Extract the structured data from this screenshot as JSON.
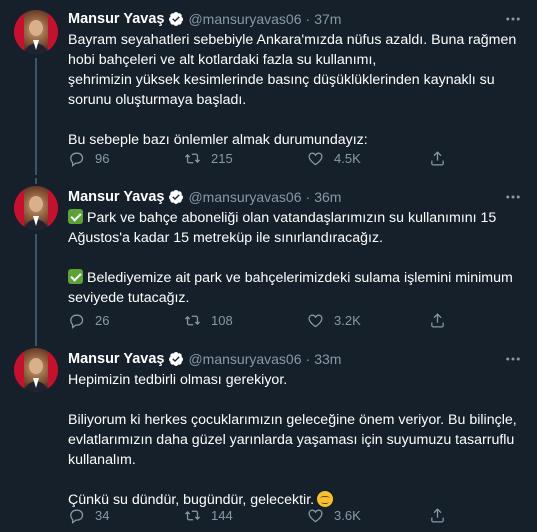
{
  "tweets": [
    {
      "name": "Mansur Yavaş",
      "handle": "@mansuryavas06",
      "dot": "·",
      "time": "37m",
      "lines": [
        "Bayram seyahatleri sebebiyle Ankara'mızda nüfus azaldı. Buna rağmen",
        "hobi bahçeleri ve alt kotlardaki fazla su kullanımı,",
        "şehrimizin yüksek kesimlerinde basınç düşüklüklerinden kaynaklı su",
        "sorunu oluşturmaya başladı.",
        "Bu sebeple bazı önlemler almak durumundayız:"
      ],
      "reply_count": "96",
      "retweet_count": "215",
      "like_count": "4.5K"
    },
    {
      "name": "Mansur Yavaş",
      "handle": "@mansuryavas06",
      "dot": "·",
      "time": "36m",
      "lines": [
        "Park ve bahçe aboneliği olan vatandaşlarımızın su kullanımını 15",
        "Ağustos'a kadar 15 metreküp ile sınırlandıracağız.",
        "Belediyemize ait park ve bahçelerimizdeki sulama işlemini minimum",
        "seviyede tutacağız."
      ],
      "reply_count": "26",
      "retweet_count": "108",
      "like_count": "3.2K"
    },
    {
      "name": "Mansur Yavaş",
      "handle": "@mansuryavas06",
      "dot": "·",
      "time": "33m",
      "lines": [
        "Hepimizin tedbirli olması gerekiyor.",
        "Biliyorum ki herkes çocuklarımızın geleceğine önem veriyor. Bu bilinçle,",
        "evlatlarımızın daha güzel yarınlarda yaşaması için suyumuzu tasarruflu",
        "kullanalım.",
        "Çünkü su dündür, bugündür, gelecektir."
      ],
      "reply_count": "34",
      "retweet_count": "144",
      "like_count": "3.6K"
    }
  ],
  "icons": {
    "verified": "verified-badge-icon",
    "more": "more-options-icon",
    "reply": "reply-icon",
    "retweet": "retweet-icon",
    "like": "like-icon",
    "share": "share-icon",
    "check": "check-mark-emoji",
    "smile": "smiling-face-emoji"
  },
  "colors": {
    "background": "#15202b",
    "text": "#ffffff",
    "muted": "#8899a6",
    "verified": "#1da1f2",
    "divider": "#38444d"
  }
}
